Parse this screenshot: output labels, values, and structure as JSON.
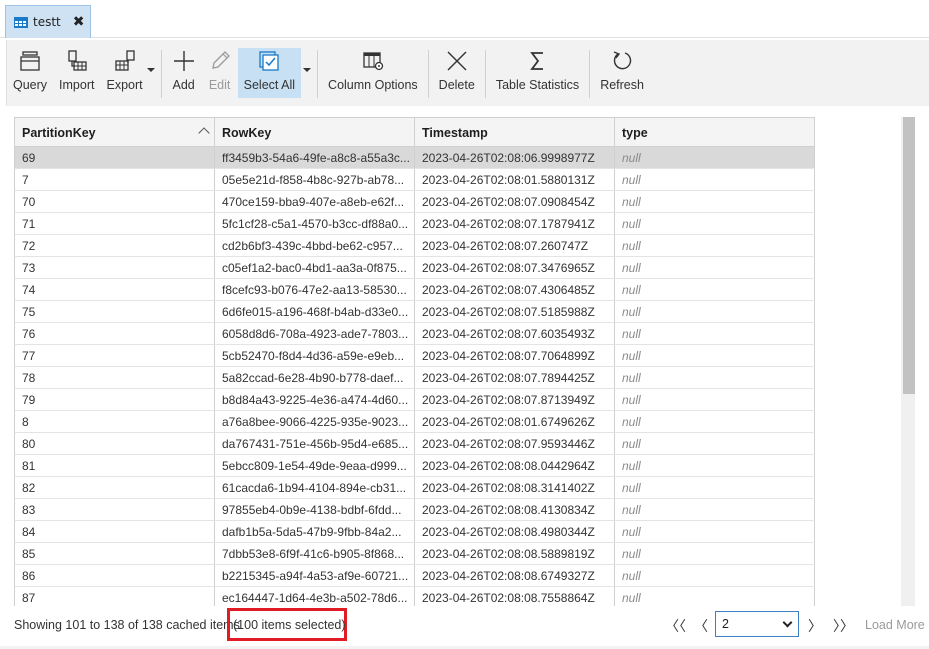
{
  "tab": {
    "label": "testt",
    "close": "✖"
  },
  "toolbar": {
    "query": "Query",
    "import": "Import",
    "export": "Export",
    "add": "Add",
    "edit": "Edit",
    "select_all": "Select All",
    "column_options": "Column Options",
    "delete": "Delete",
    "table_statistics": "Table Statistics",
    "refresh": "Refresh"
  },
  "grid": {
    "columns": [
      "PartitionKey",
      "RowKey",
      "Timestamp",
      "type"
    ],
    "rows": [
      [
        "69",
        "ff3459b3-54a6-49fe-a8c8-a55a3c...",
        "2023-04-26T02:08:06.9998977Z",
        "null"
      ],
      [
        "7",
        "05e5e21d-f858-4b8c-927b-ab78...",
        "2023-04-26T02:08:01.5880131Z",
        "null"
      ],
      [
        "70",
        "470ce159-bba9-407e-a8eb-e62f...",
        "2023-04-26T02:08:07.0908454Z",
        "null"
      ],
      [
        "71",
        "5fc1cf28-c5a1-4570-b3cc-df88a0...",
        "2023-04-26T02:08:07.1787941Z",
        "null"
      ],
      [
        "72",
        "cd2b6bf3-439c-4bbd-be62-c957...",
        "2023-04-26T02:08:07.260747Z",
        "null"
      ],
      [
        "73",
        "c05ef1a2-bac0-4bd1-aa3a-0f875...",
        "2023-04-26T02:08:07.3476965Z",
        "null"
      ],
      [
        "74",
        "f8cefc93-b076-47e2-aa13-58530...",
        "2023-04-26T02:08:07.4306485Z",
        "null"
      ],
      [
        "75",
        "6d6fe015-a196-468f-b4ab-d33e0...",
        "2023-04-26T02:08:07.5185988Z",
        "null"
      ],
      [
        "76",
        "6058d8d6-708a-4923-ade7-7803...",
        "2023-04-26T02:08:07.6035493Z",
        "null"
      ],
      [
        "77",
        "5cb52470-f8d4-4d36-a59e-e9eb...",
        "2023-04-26T02:08:07.7064899Z",
        "null"
      ],
      [
        "78",
        "5a82ccad-6e28-4b90-b778-daef...",
        "2023-04-26T02:08:07.7894425Z",
        "null"
      ],
      [
        "79",
        "b8d84a43-9225-4e36-a474-4d60...",
        "2023-04-26T02:08:07.8713949Z",
        "null"
      ],
      [
        "8",
        "a76a8bee-9066-4225-935e-9023...",
        "2023-04-26T02:08:01.6749626Z",
        "null"
      ],
      [
        "80",
        "da767431-751e-456b-95d4-e685...",
        "2023-04-26T02:08:07.9593446Z",
        "null"
      ],
      [
        "81",
        "5ebcc809-1e54-49de-9eaa-d999...",
        "2023-04-26T02:08:08.0442964Z",
        "null"
      ],
      [
        "82",
        "61cacda6-1b94-4104-894e-cb31...",
        "2023-04-26T02:08:08.3141402Z",
        "null"
      ],
      [
        "83",
        "97855eb4-0b9e-4138-bdbf-6fdd...",
        "2023-04-26T02:08:08.4130834Z",
        "null"
      ],
      [
        "84",
        "dafb1b5a-5da5-47b9-9fbb-84a2...",
        "2023-04-26T02:08:08.4980344Z",
        "null"
      ],
      [
        "85",
        "7dbb53e8-6f9f-41c6-b905-8f868...",
        "2023-04-26T02:08:08.5889819Z",
        "null"
      ],
      [
        "86",
        "b2215345-a94f-4a53-af9e-60721...",
        "2023-04-26T02:08:08.6749327Z",
        "null"
      ],
      [
        "87",
        "ec164447-1d64-4e3b-a502-78d6...",
        "2023-04-26T02:08:08.7558864Z",
        "null"
      ]
    ]
  },
  "status": {
    "showing": "Showing 101 to 138 of 138 cached items",
    "selected": "(100 items selected)",
    "first": "〈〈",
    "prev": "〈",
    "page": "2",
    "next": "〉",
    "last": "〉〉",
    "load_more": "Load More"
  },
  "colors": {
    "accent": "#1979ca",
    "highlight": "#e01b24",
    "selected_row": "#d9d9d9",
    "active_button": "#c7e0f4"
  }
}
